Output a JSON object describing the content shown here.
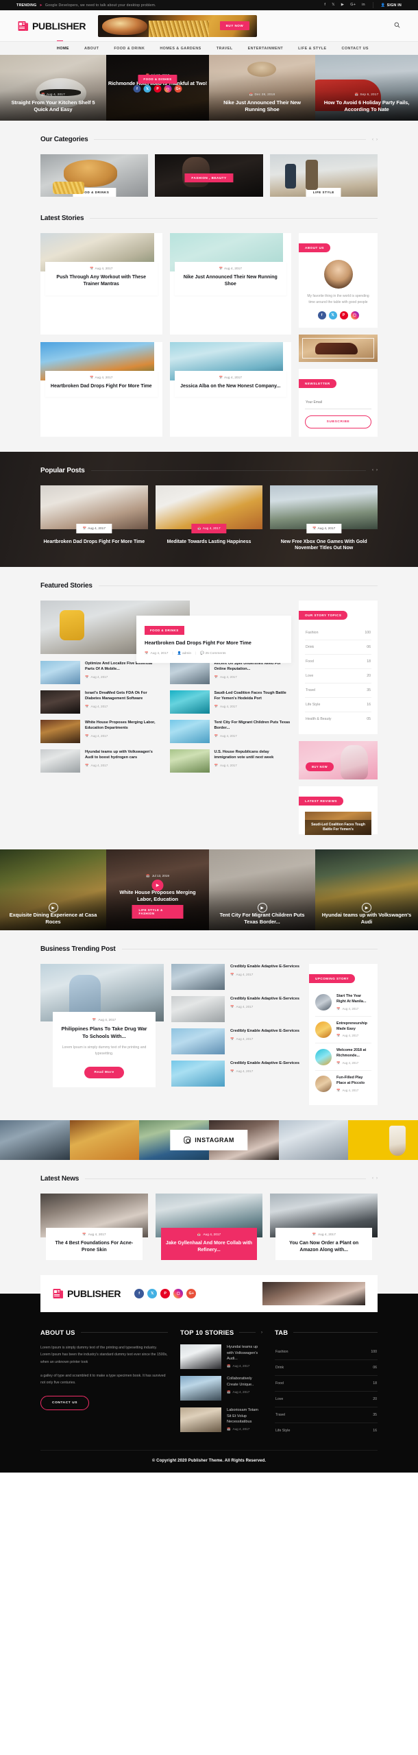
{
  "topbar": {
    "label": "TRENDING",
    "arrow": "➤",
    "text": "Google Developers, we need to talk about your desktop problem.",
    "socials": [
      "f",
      "𝕏",
      "▶",
      "G+",
      "in"
    ],
    "signin": "SIGN IN"
  },
  "header": {
    "logo_text": "PUBLISHER",
    "banner_cta": "BUY NOW",
    "search_icon": "search-icon"
  },
  "nav": {
    "items": [
      {
        "label": "HOME",
        "active": true
      },
      {
        "label": "ABOUT",
        "active": false
      },
      {
        "label": "FOOD & DRINK",
        "active": false
      },
      {
        "label": "HOMES & GARDENS",
        "active": false
      },
      {
        "label": "TRAVEL",
        "active": false
      },
      {
        "label": "ENTERTAINMENT",
        "active": false
      },
      {
        "label": "LIFE & STYLE",
        "active": false
      },
      {
        "label": "CONTACT US",
        "active": false
      }
    ]
  },
  "hero": {
    "slide1": {
      "date": "Aug 4, 2017",
      "title": "Straight From Your Kitchen Shelf 5 Quick And Easy"
    },
    "slide2": {
      "date": "Jul 13, 2019",
      "title": "Richmonde Hotel Iloilo is Thankful at Two!",
      "category": "FOOD & DISHES"
    },
    "slide3": {
      "date": "Dec 28, 2018",
      "title": "Nike Just Announced Their New Running Shoe"
    },
    "slide4": {
      "date": "Sep 6, 2017",
      "title": "How To Avoid 6 Holiday Party Fails, According To Nate"
    }
  },
  "categories": {
    "title": "Our Categories",
    "items": [
      {
        "label": "FOOD & DRINKS",
        "style": "white"
      },
      {
        "label": "FASHION , BEAUTY",
        "style": "pink"
      },
      {
        "label": "LIFE STYLE",
        "style": "white"
      }
    ]
  },
  "latest_stories": {
    "title": "Latest Stories",
    "posts": [
      {
        "date": "Aug 4, 2017",
        "title": "Push Through Any Workout with These Trainer Mantras"
      },
      {
        "date": "Aug 4, 2017",
        "title": "Nike Just Announced Their New Running Shoe"
      },
      {
        "date": "Aug 4, 2017",
        "title": "Heartbroken Dad Drops Fight For More Time"
      },
      {
        "date": "Aug 4, 2017",
        "title": "Jessica Alba on the New Honest Company..."
      }
    ],
    "about": {
      "tag": "ABOUT US",
      "text": "My favorite thing in the world is spending time around the table with good people"
    },
    "newsletter": {
      "tag": "NEWSLETTER",
      "placeholder": "Your Email",
      "button": "SUBSCRIBE"
    }
  },
  "popular": {
    "title": "Popular Posts",
    "posts": [
      {
        "date": "Aug 4, 2017",
        "title": "Heartbroken Dad Drops Fight For More Time",
        "highlight": false
      },
      {
        "date": "Aug 4, 2017",
        "title": "Meditate Towards Lasting Happiness",
        "highlight": true
      },
      {
        "date": "Aug 4, 2017",
        "title": "New Free Xbox One Games With Gold November Titles Out Now",
        "highlight": false
      }
    ]
  },
  "featured": {
    "title": "Featured Stories",
    "hero": {
      "badge": "FOOD & DRINKS",
      "title": "Heartbroken Dad Drops Fight For More Time",
      "date": "Aug 4, 2017",
      "author": "admin",
      "comments": "25 Comments"
    },
    "items": [
      {
        "title": "Optimize And Localize Five Essential Parts Of A Mobile...",
        "date": "Aug 4, 2017"
      },
      {
        "title": "Recent Oil Spill Underlines Need For Online Reputation...",
        "date": "Aug 4, 2017"
      },
      {
        "title": "Israel's DreaMed Gets FDA Ok For Diabetes Management Software",
        "date": "Aug 4, 2017"
      },
      {
        "title": "Saudi-Led Coalition Faces Tough Battle For Yemen's Hodeida Port",
        "date": "Aug 4, 2017"
      },
      {
        "title": "White House Proposes Merging Labor, Education Departments",
        "date": "Aug 4, 2017"
      },
      {
        "title": "Tent City For Migrant Children Puts Texas Border...",
        "date": "Aug 4, 2017"
      },
      {
        "title": "Hyundai teams up with Volkswagen's Audi to boost hydrogen cars",
        "date": "Aug 4, 2017"
      },
      {
        "title": "U.S. House Republicans delay immigration vote until next week",
        "date": "Aug 4, 2017"
      }
    ],
    "sidebar": {
      "topics_tag": "OUR STORY TOPICS",
      "topics": [
        {
          "name": "Fashion",
          "count": "100"
        },
        {
          "name": "Drink",
          "count": "06"
        },
        {
          "name": "Food",
          "count": "18"
        },
        {
          "name": "Love",
          "count": "20"
        },
        {
          "name": "Travel",
          "count": "35"
        },
        {
          "name": "Life Style",
          "count": "16"
        },
        {
          "name": "Health & Beauty",
          "count": "05"
        }
      ],
      "ad_cta": "BUY NOW",
      "reviews_tag": "LATEST REVIEWS",
      "review_title": "Saudi-Led Coalition Faces Tough Battle For Yemen's"
    }
  },
  "videos": [
    {
      "title": "Exquisite Dining Experience at Casa Roces",
      "play": "play-icon"
    },
    {
      "title": "White House Proposes Merging Labor, Education",
      "date": "Jul 13, 2019",
      "badge": "LIFE STYLE & FASHION",
      "play": "play-icon"
    },
    {
      "title": "Tent City For Migrant Children Puts Texas Border...",
      "play": "play-icon"
    },
    {
      "title": "Hyundai teams up with Volkswagen's Audi",
      "play": "play-icon"
    }
  ],
  "business": {
    "title": "Business Trending Post",
    "main": {
      "date": "Aug 4, 2017",
      "title": "Philippines Plans To Take Drug War To Schools With...",
      "desc": "Lorem Ipsum is simply dummy text of the printing and typesetting.",
      "button": "Read More"
    },
    "list": [
      {
        "title": "Credibly Enable Adaptive E-Services",
        "date": "Aug 4, 2017"
      },
      {
        "title": "Credibly Enable Adaptive E-Services",
        "date": "Aug 4, 2017"
      },
      {
        "title": "Credibly Enable Adaptive E-Services",
        "date": "Aug 4, 2017"
      },
      {
        "title": "Credibly Enable Adaptive E-Services",
        "date": "Aug 4, 2017"
      }
    ],
    "upcoming": {
      "tag": "UPCOMING STORY",
      "items": [
        {
          "title": "Start The Year Right At Manila...",
          "date": "Aug 4, 2017"
        },
        {
          "title": "Entrepreneurship Made Easy",
          "date": "Aug 4, 2017"
        },
        {
          "title": "Welcome 2018 at Richmonde...",
          "date": "Aug 4, 2017"
        },
        {
          "title": "Fun-Filled Play Place at Piccolo",
          "date": "Aug 4, 2017"
        }
      ]
    }
  },
  "instagram": {
    "label": "INSTAGRAM",
    "icon": "instagram-icon"
  },
  "latest_news": {
    "title": "Latest News",
    "posts": [
      {
        "date": "Aug 4, 2017",
        "title": "The 4 Best Foundations For Acne-Prone Skin",
        "highlight": false
      },
      {
        "date": "Aug 4, 2017",
        "title": "Jake Gyllenhaal And More Collab with Refinery...",
        "highlight": true
      },
      {
        "date": "Aug 4, 2017",
        "title": "You Can Now Order a Plant on Amazon Along with...",
        "highlight": false
      }
    ]
  },
  "promo": {
    "logo_text": "PUBLISHER"
  },
  "footer": {
    "about": {
      "title": "ABOUT US",
      "p1": "Lorem Ipsum is simply dummy text of the printing and typesetting industry. Lorem Ipsum has been the industry's standard dummy text ever since the 1500s, when an unknown printer took",
      "p2": " a galley of type and scrambled it to make a type specimen book. It has survived not only five centuries.",
      "button": "CONTACT US"
    },
    "top_stories": {
      "title": "TOP 10 STORIES",
      "items": [
        {
          "title": "Hyundai teams up with Volkswagen's Audi...",
          "date": "Aug 4, 2017"
        },
        {
          "title": "Collaboratively Create Unique..",
          "date": "Aug 4, 2017"
        },
        {
          "title": "Laboriosam Totam Sit Et Volup Necessitatibus",
          "date": "Aug 4, 2017"
        }
      ]
    },
    "tab": {
      "title": "TAB",
      "items": [
        {
          "name": "Fashion",
          "count": "100"
        },
        {
          "name": "Drink",
          "count": "06"
        },
        {
          "name": "Food",
          "count": "18"
        },
        {
          "name": "Love",
          "count": "20"
        },
        {
          "name": "Travel",
          "count": "35"
        },
        {
          "name": "Life Style",
          "count": "16"
        }
      ]
    },
    "copyright": "© Copyright 2020 Publisher Theme. All Rights Reserved."
  },
  "colors": {
    "accent": "#ef2d66",
    "dark": "#0a0a0a",
    "page_bg": "#f4f4f4"
  }
}
